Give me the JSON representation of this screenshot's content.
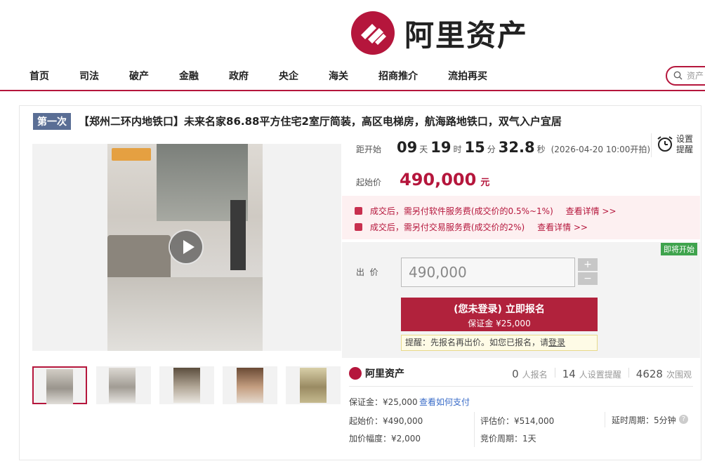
{
  "brand": {
    "name": "阿里资产"
  },
  "nav": {
    "items": [
      "首页",
      "司法",
      "破产",
      "金融",
      "政府",
      "央企",
      "海关",
      "招商推介",
      "流拍再买"
    ],
    "search_placeholder": "资产"
  },
  "listing": {
    "round_badge": "第一次",
    "title": "【郑州二环内地铁口】未来名家86.88平方住宅2室厅简装，高区电梯房，航海路地铁口，双气入户宜居",
    "countdown": {
      "label": "距开始",
      "days": "09",
      "days_unit": "天",
      "hours": "19",
      "hours_unit": "时",
      "minutes": "15",
      "minutes_unit": "分",
      "seconds": "32.8",
      "seconds_unit": "秒",
      "start_time": "(2026-04-20 10:00开拍)"
    },
    "reminder_label": "设置提醒",
    "start_price_label": "起始价",
    "start_price": "490,000",
    "price_unit": "元",
    "fees": [
      {
        "text": "成交后，需另付软件服务费(成交价的0.5%~1%)",
        "link": "查看详情 >>"
      },
      {
        "text": "成交后，需另付交易服务费(成交价的2%)",
        "link": "查看详情 >>"
      }
    ],
    "status_badge": "即将开始",
    "bid": {
      "label": "出  价",
      "value": "490,000",
      "plus": "+",
      "minus": "−",
      "signup_title": "(您未登录) 立即报名",
      "signup_deposit": "保证金 ¥25,000",
      "tip_prefix": "提醒：先报名再出价。如您已报名，请",
      "tip_link": "登录"
    },
    "stats": {
      "brand": "阿里资产",
      "registrations": "0",
      "registrations_label": "人报名",
      "reminders": "14",
      "reminders_label": "人设置提醒",
      "views": "4628",
      "views_label": "次围观"
    },
    "deposit_row": {
      "text": "保证金：¥25,000",
      "link": "查看如何支付"
    },
    "details": {
      "start_price": "起始价：¥490,000",
      "appraisal": "评估价：¥514,000",
      "extension": "延时周期：5分钟",
      "increment": "加价幅度：¥2,000",
      "bid_period": "竞价周期：1天"
    }
  },
  "colors": {
    "brand": "#b5163c",
    "badge": "#5a6e95",
    "status": "#3fa34d"
  }
}
